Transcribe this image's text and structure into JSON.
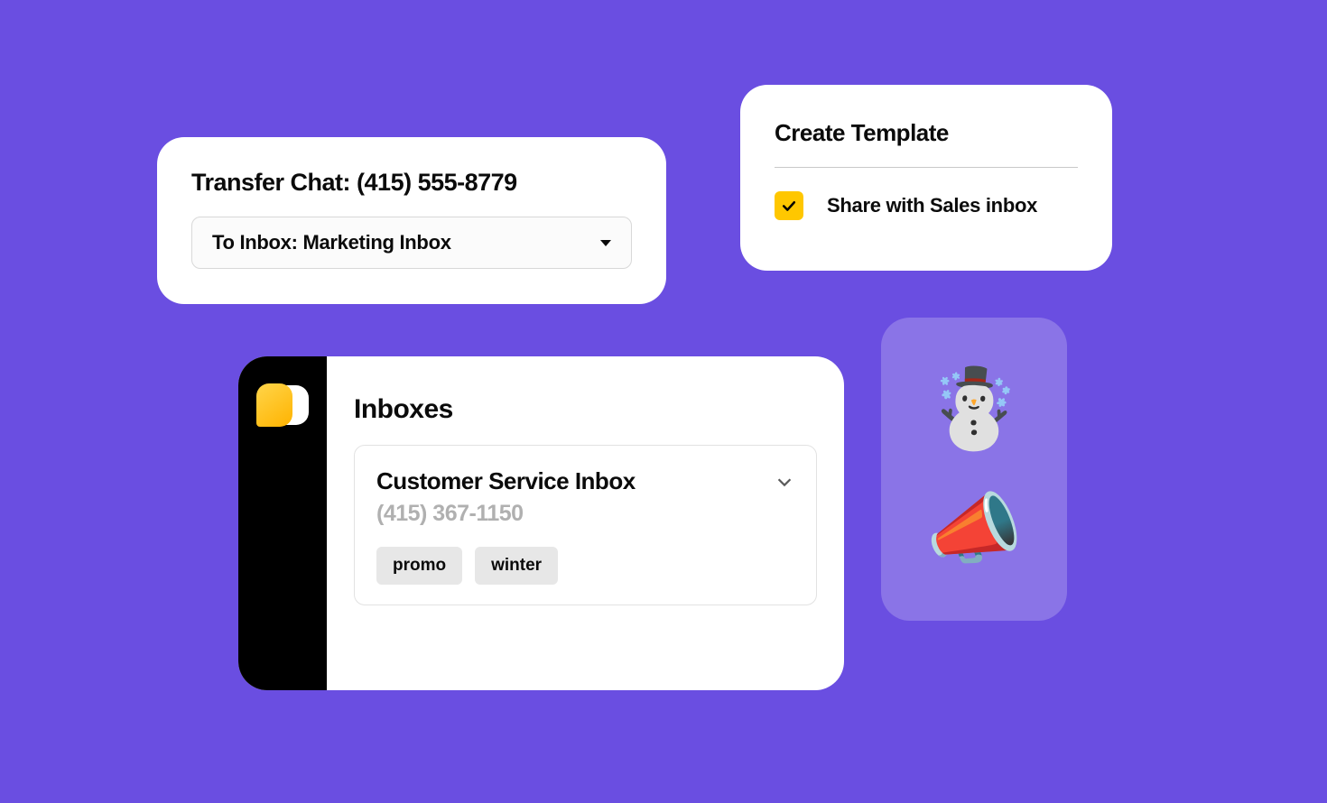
{
  "transfer": {
    "title": "Transfer Chat: (415) 555-8779",
    "select_label": "To Inbox: Marketing Inbox"
  },
  "template": {
    "title": "Create Template",
    "checkbox_label": "Share with Sales inbox",
    "checked": true
  },
  "inboxes": {
    "title": "Inboxes",
    "current": {
      "name": "Customer Service Inbox",
      "phone": "(415) 367-1150",
      "tags": [
        "promo",
        "winter"
      ]
    }
  },
  "emoji_pill": {
    "items": [
      "☃️",
      "📣"
    ]
  }
}
